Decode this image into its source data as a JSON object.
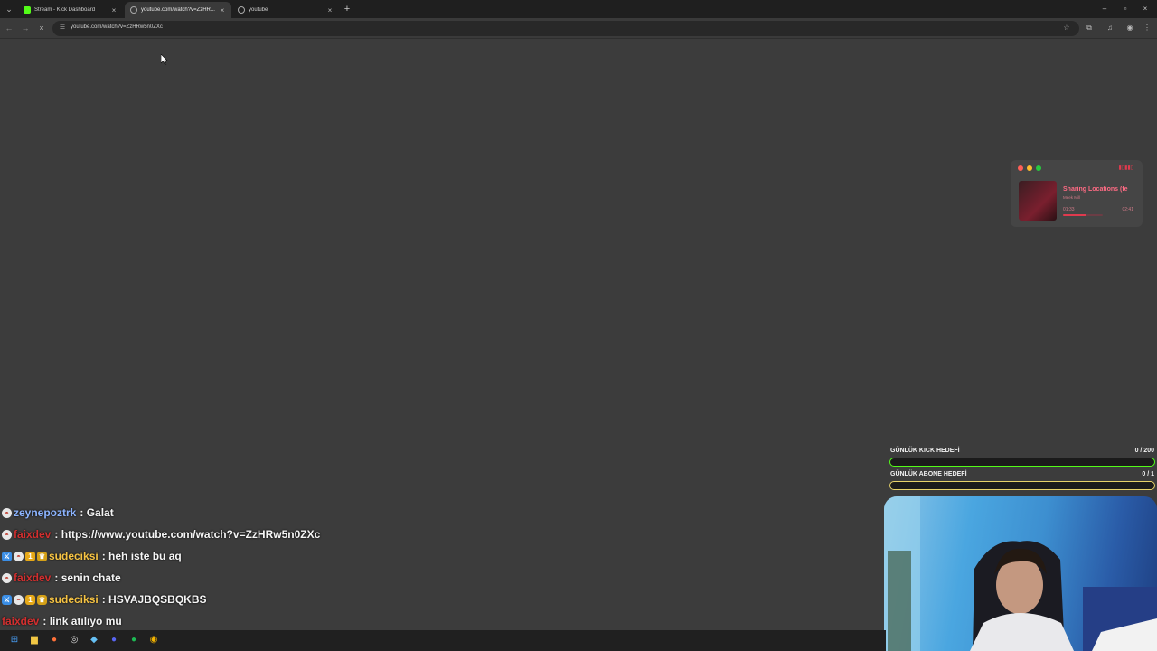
{
  "browser": {
    "tabs": [
      {
        "label": "Stream - Kick Dashboard",
        "icon": "kick-icon",
        "active": false
      },
      {
        "label": "youtube.com/watch?v=ZzHR...",
        "icon": "globe-icon",
        "active": true
      },
      {
        "label": "youtube",
        "icon": "globe-icon",
        "active": false
      }
    ],
    "url": "youtube.com/watch?v=ZzHRw5n0ZXc",
    "accent": "#53fc18"
  },
  "music": {
    "song": "Sharing Locations (fe",
    "artist": "Meek Mill",
    "current_time": "01:33",
    "total_time": "02:41",
    "progress": 0.58,
    "accent": "#e03a4e"
  },
  "goals": [
    {
      "label": "GÜNLÜK KICK HEDEFİ",
      "count": "0 / 200",
      "color": "#53fc18"
    },
    {
      "label": "GÜNLÜK ABONE HEDEFİ",
      "count": "0 / 1",
      "color": "#e8d36a"
    }
  ],
  "chat": [
    {
      "user": "zeynepoztrk",
      "user_color": "#8cb4ff",
      "message": ": Galat",
      "badges": [
        "pokeball-icon"
      ]
    },
    {
      "user": "faixdev",
      "user_color": "#d32f2f",
      "message": ": https://www.youtube.com/watch?v=ZzHRw5n0ZXc",
      "badges": [
        "pokeball-icon"
      ]
    },
    {
      "user": "sudeciksi",
      "user_color": "#f6c343",
      "message": ": heh iste bu aq",
      "badges": [
        "sword-icon",
        "pokeball-icon",
        "coin-icon",
        "crown-icon"
      ]
    },
    {
      "user": "faixdev",
      "user_color": "#d32f2f",
      "message": ": senin chate",
      "badges": [
        "pokeball-icon"
      ]
    },
    {
      "user": "sudeciksi",
      "user_color": "#f6c343",
      "message": ": HSVAJBQSBQKBS",
      "badges": [
        "sword-icon",
        "pokeball-icon",
        "coin-icon",
        "crown-icon"
      ]
    },
    {
      "user": "faixdev",
      "user_color": "#d32f2f",
      "message": ": link atılıyo mu",
      "badges": []
    }
  ],
  "taskbar": {
    "apps": [
      "windows-start-icon",
      "file-explorer-icon",
      "firefox-icon",
      "obs-icon",
      "steam-icon",
      "discord-icon",
      "spotify-icon",
      "chrome-icon"
    ]
  }
}
